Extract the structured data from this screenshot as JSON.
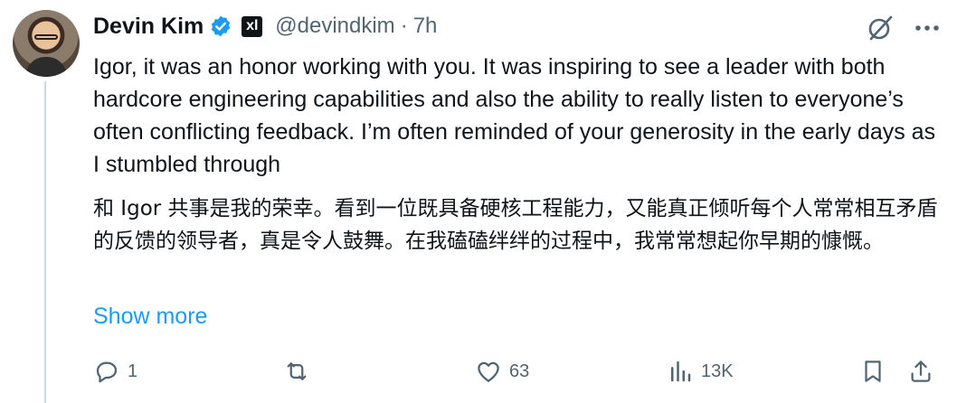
{
  "author": {
    "name": "Devin Kim",
    "handle": "@devindkim",
    "separator": "·",
    "time": "7h",
    "org_badge": "xl"
  },
  "tweet": {
    "text_en": "Igor, it was an honor working with you. It was inspiring to see a leader with both hardcore engineering capabilities and also the ability to really listen to everyone’s often conflicting feedback. I’m often reminded of your generosity in the early days as I stumbled through",
    "text_zh": "和 Igor 共事是我的荣幸。看到一位既具备硬核工程能力，又能真正倾听每个人常常相互矛盾的反馈的领导者，真是令人鼓舞。在我磕磕绊绊的过程中，我常常想起你早期的慷慨。",
    "show_more": "Show more"
  },
  "actions": {
    "replies": "1",
    "reposts": "",
    "likes": "63",
    "views": "13K"
  },
  "colors": {
    "accent": "#1d9bf0",
    "secondary_text": "#536471",
    "thread_line": "#cfd9de"
  }
}
